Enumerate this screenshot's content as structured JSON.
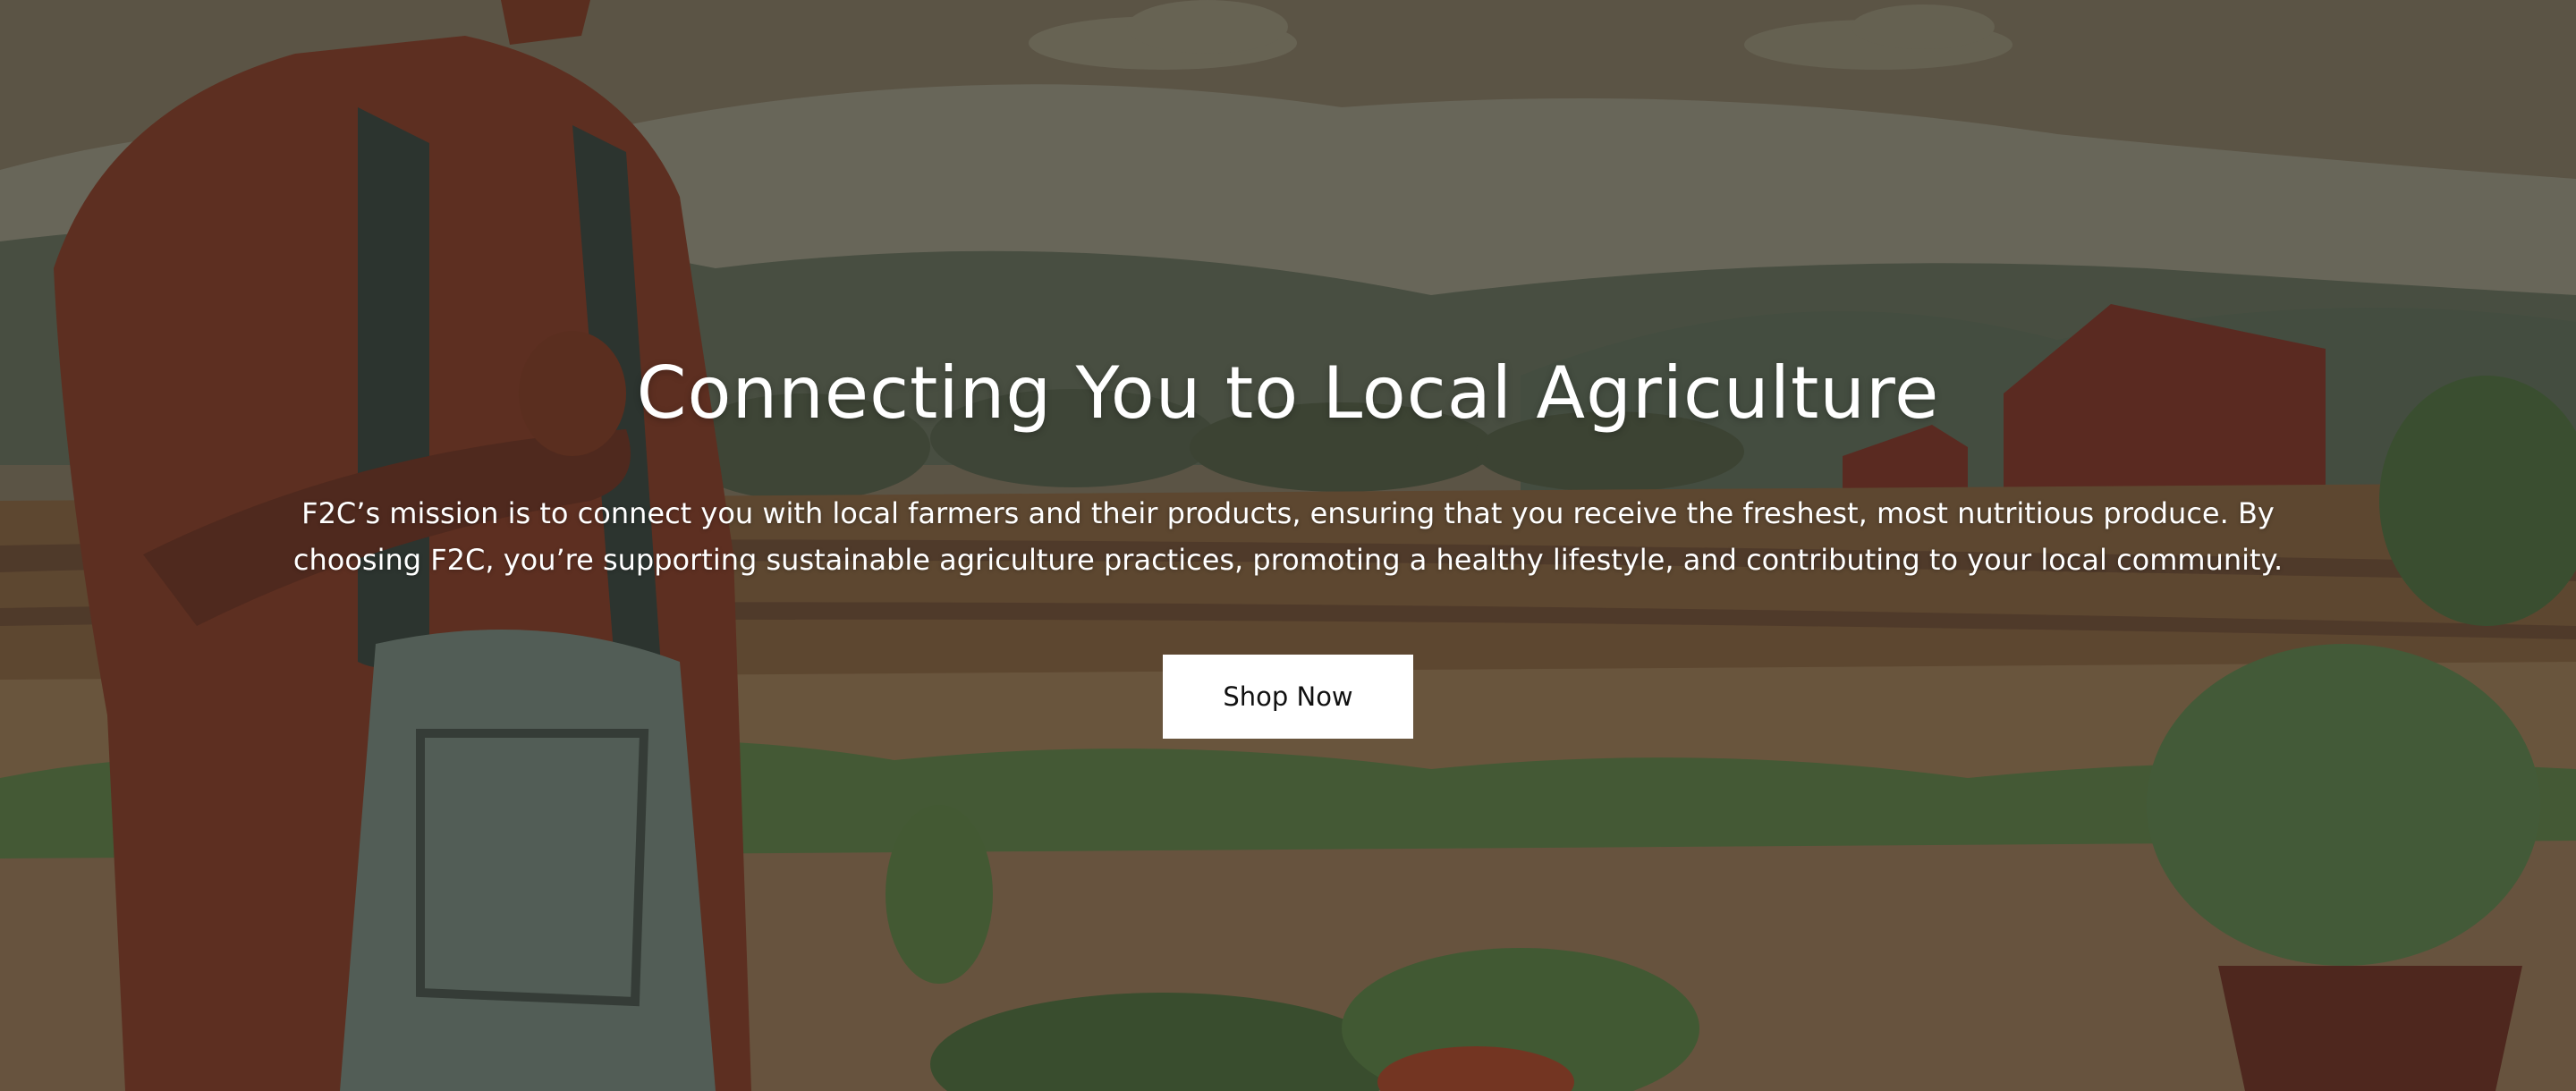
{
  "hero": {
    "title": "Connecting You to Local Agriculture",
    "description": "F2C’s mission is to connect you with local farmers and their products, ensuring that you receive the freshest, most nutritious produce. By choosing F2C, you’re supporting sustainable agriculture practices, promoting a healthy lifestyle, and contributing to your local community.",
    "cta_label": "Shop Now"
  },
  "colors": {
    "sky": "#6e6656",
    "hills": "#555f50",
    "field": "#7a5f45",
    "barn": "#6a2e24",
    "shirt": "#6e3424",
    "overalls": "#5f6f68",
    "button_bg": "#ffffff",
    "button_text": "#111111"
  }
}
